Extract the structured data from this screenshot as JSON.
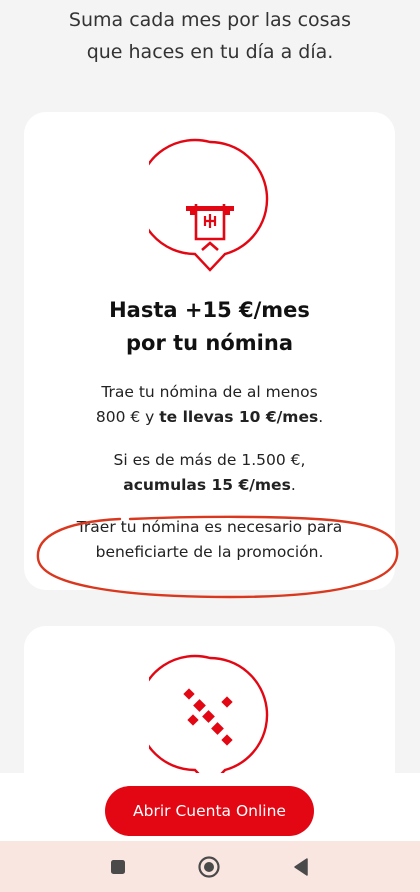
{
  "intro": {
    "line1": "Suma cada mes por las cosas",
    "line2": "que haces en tu día a día."
  },
  "card1": {
    "icon": "atm-cash-withdrawal-icon",
    "title_line1": "Hasta +15 €/mes",
    "title_line2": "por tu nómina",
    "para1": {
      "line1": "Trae tu nómina de al menos",
      "line2_prefix": "800 € y ",
      "line2_bold": "te llevas 10 €/mes",
      "line2_suffix": "."
    },
    "para2": {
      "line1": "Si es de más de 1.500 €,",
      "line2_bold": "acumulas 15 €/mes",
      "line2_suffix": "."
    },
    "para3": {
      "line1": "Traer tu nómina es necesario para",
      "line2": "beneficiarte de la promoción."
    }
  },
  "card2": {
    "icon": "percent-icon"
  },
  "cta": {
    "label": "Abrir Cuenta Online"
  },
  "nav": {
    "recent_icon": "square-icon",
    "home_icon": "circle-home-icon",
    "back_icon": "triangle-back-icon"
  },
  "colors": {
    "brand_red": "#e30613",
    "background": "#f4f4f4",
    "nav_bar": "#f9e6e1",
    "annotation": "#d9381e"
  }
}
